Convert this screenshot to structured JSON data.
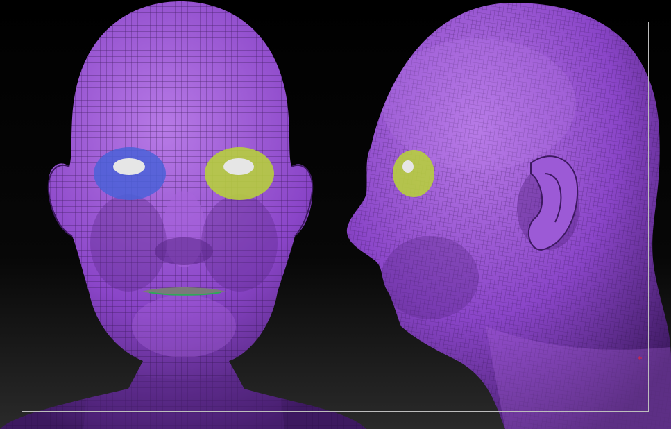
{
  "viewport": {
    "background_top": "#000000",
    "background_bottom": "#2a2a2a"
  },
  "model": {
    "skin_color": "#8a45c8",
    "skin_highlight": "#b77ae6",
    "skin_shadow": "#4a1f72",
    "wire_color": "#2a0f45",
    "eye_mask_left_color": "#4a62d8",
    "eye_mask_right_color": "#b7d23a",
    "eyeball_color": "#e6e6e6",
    "teeth_color": "#8a8a8a",
    "mouth_line_color": "#2fa85a"
  },
  "views": {
    "front": "front-view-head",
    "side": "side-view-head"
  },
  "frame_color": "#bdbdbd",
  "marker_color": "#d0264a"
}
